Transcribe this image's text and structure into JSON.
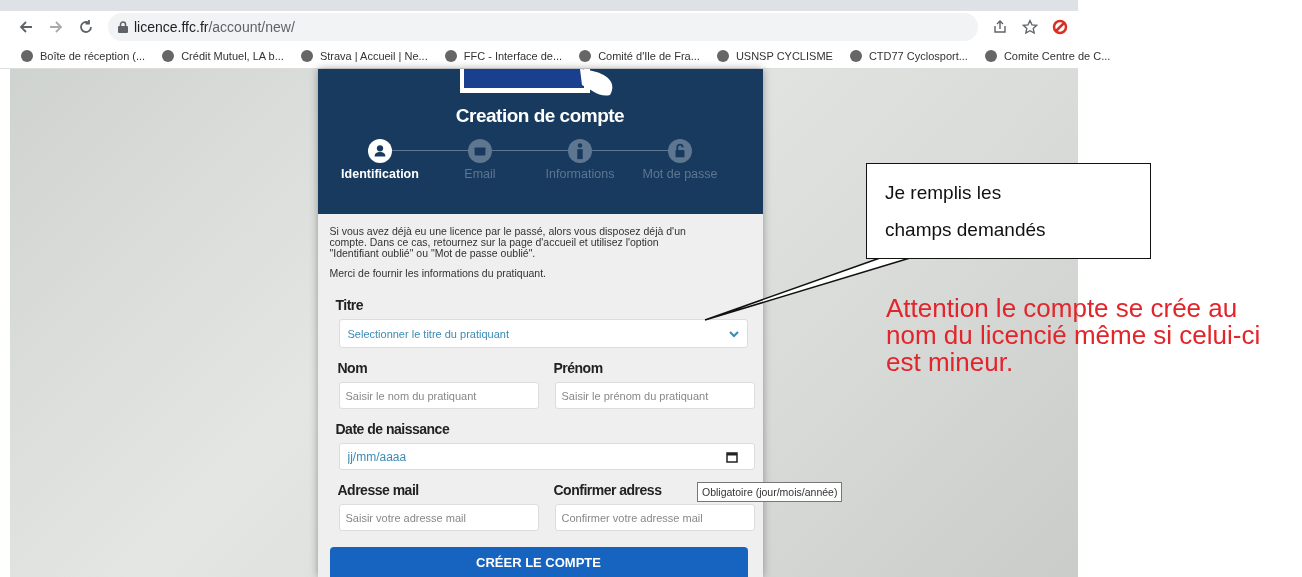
{
  "browser": {
    "url_host": "licence.ffc.fr",
    "url_path": "/account/new/",
    "bookmarks": [
      {
        "label": "Boîte de réception (..."
      },
      {
        "label": "Crédit Mutuel, LA b..."
      },
      {
        "label": "Strava | Accueil | Ne..."
      },
      {
        "label": "FFC - Interface de..."
      },
      {
        "label": "Comité d'Ile de Fra..."
      },
      {
        "label": "USNSP CYCLISME"
      },
      {
        "label": "CTD77 Cyclosport..."
      },
      {
        "label": "Comite Centre de C..."
      }
    ]
  },
  "form": {
    "title": "Creation de compte",
    "steps": [
      {
        "label": "Identification",
        "selected": true
      },
      {
        "label": "Email",
        "selected": false
      },
      {
        "label": "Informations",
        "selected": false
      },
      {
        "label": "Mot de passe",
        "selected": false
      }
    ],
    "intro": "Si vous avez déjà eu une licence par le passé, alors vous disposez déjà d'un compte. Dans ce cas, retournez sur la page d'accueil et utilisez l'option \"Identifiant oublié\" ou \"Mot de passe oublié\".",
    "note": "Merci de fournir les informations du pratiquant.",
    "title_field": {
      "label": "Titre",
      "placeholder": "Selectionner le titre du pratiquant"
    },
    "nom": {
      "label": "Nom",
      "placeholder": "Saisir le nom du pratiquant"
    },
    "prenom": {
      "label": "Prénom",
      "placeholder": "Saisir le prénom du pratiquant"
    },
    "birth": {
      "label": "Date de naissance",
      "placeholder": "jj/mm/aaaa"
    },
    "email": {
      "label": "Adresse mail",
      "placeholder": "Saisir votre adresse mail"
    },
    "email_confirm": {
      "label": "Confirmer adress",
      "placeholder": "Confirmer votre adresse mail"
    },
    "tooltip": "Obligatoire (jour/mois/année)",
    "submit": "CRÉER LE COMPTE"
  },
  "callout": {
    "lines": [
      "Je remplis les",
      "champs demandés"
    ]
  },
  "warning": "Attention le compte se crée au nom du licencié même si celui-ci est mineur."
}
